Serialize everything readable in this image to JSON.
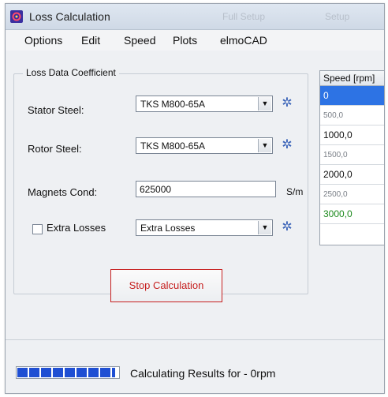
{
  "window": {
    "title": "Loss Calculation",
    "ghost_left": "Full Setup",
    "ghost_right": "Setup"
  },
  "menubar": {
    "items": [
      "Options",
      "Edit",
      "Speed",
      "Plots",
      "elmoCAD"
    ]
  },
  "loss_data": {
    "group_title": "Loss Data Coefficient",
    "stator_steel_label": "Stator Steel:",
    "stator_steel_value": "TKS  M800-65A",
    "rotor_steel_label": "Rotor Steel:",
    "rotor_steel_value": "TKS  M800-65A",
    "magnets_cond_label": "Magnets Cond:",
    "magnets_cond_value": "625000",
    "magnets_cond_unit": "S/m",
    "extra_losses_checkbox_label": "Extra Losses",
    "extra_losses_value": "Extra  Losses",
    "extra_losses_checked": false
  },
  "speed_table": {
    "header": "Speed [rpm]",
    "rows": [
      "0",
      "500,0",
      "1000,0",
      "1500,0",
      "2000,0",
      "2500,0",
      "3000,0"
    ],
    "selected_index": 0,
    "highlight_color": "#2d73e4",
    "last_row_color": "#1d8a1d"
  },
  "actions": {
    "stop_label": "Stop Calculation",
    "stop_color": "#c61f1f"
  },
  "status": {
    "progress": 0.95,
    "text": "Calculating Results for - 0rpm"
  }
}
